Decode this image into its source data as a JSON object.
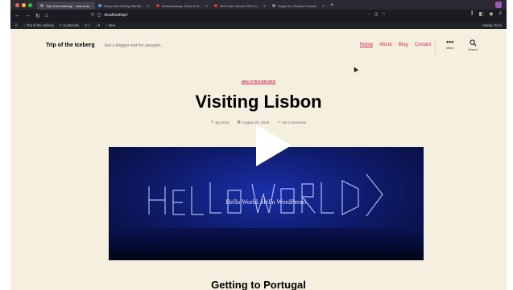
{
  "browser": {
    "tabs": [
      {
        "label": "Trip of the Iceberg – Just a blo…",
        "active": true
      },
      {
        "label": "Setup and Getting Started…",
        "active": false
      },
      {
        "label": "ddufordsmaay: Show & Hi…",
        "active": false
      },
      {
        "label": "286 Listen Shows 2020 In…",
        "active": false
      },
      {
        "label": "Origin of a Passion Parade…",
        "active": false
      }
    ],
    "url": "localhost/wp/",
    "colors": {
      "chrome": "#2b2a33",
      "toolbar": "#1c1b22"
    }
  },
  "admin_bar": {
    "items": [
      "Trip of the Iceberg",
      "Customize",
      "1",
      "0",
      "+ New"
    ],
    "howdy": "Howdy, Erica"
  },
  "site": {
    "title": "Trip of the Iceberg",
    "tagline": "Just a blogger and her passport.",
    "menu": [
      "Home",
      "About",
      "Blog",
      "Contact"
    ],
    "menu_label": "Menu",
    "search_label": "Search"
  },
  "post": {
    "category": "UNCATEGORIZED",
    "title": "Visiting Lisbon",
    "author": "By Erica",
    "date": "August 20, 2020",
    "comments": "No Comments",
    "hero_text": "Hello World. Hello WordPress!",
    "next_heading": "Getting to Portugal"
  },
  "colors": {
    "accent": "#cd2653",
    "background": "#f5efe0"
  }
}
